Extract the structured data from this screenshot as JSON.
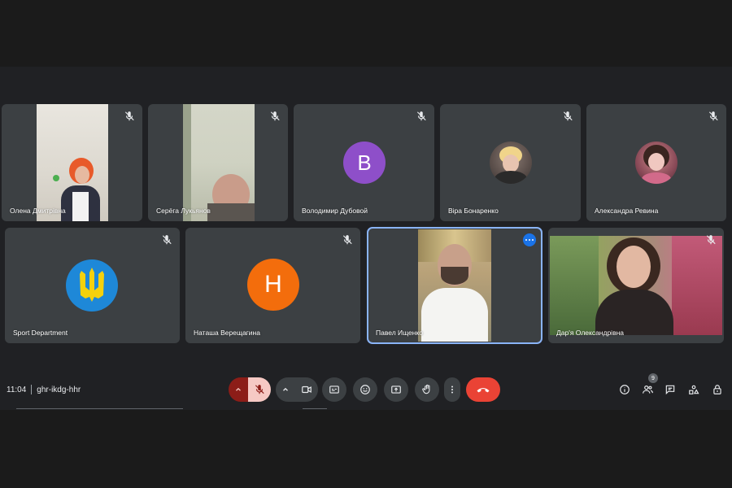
{
  "meeting": {
    "time": "11:04",
    "code": "ghr-ikdg-hhr"
  },
  "participants": [
    {
      "name": "Олена Дмитрівна"
    },
    {
      "name": "Серёга Лукьянов"
    },
    {
      "name": "Володимир Дубовой",
      "initial": "B"
    },
    {
      "name": "Віра Бонаренко"
    },
    {
      "name": "Александра Ревина"
    },
    {
      "name": "Sport Department"
    },
    {
      "name": "Наташа Верещагина",
      "initial": "H"
    },
    {
      "name": "Павел Ищенко"
    },
    {
      "name": "Дар'я Олександрівна"
    }
  ],
  "participants_badge": "9",
  "colors": {
    "tile_bg": "#3c4043",
    "avatar_purple": "#8e4fc9",
    "avatar_orange": "#f36d0c",
    "end_call_red": "#ea4335",
    "mic_muted_red": "#8c1d18",
    "active_outline": "#8ab4f8",
    "ukraine_blue": "#1e88d8",
    "ukraine_yellow": "#f5d10d"
  },
  "icons": {
    "tile": [
      "mic-off-icon",
      "more-options-icon"
    ],
    "controls": [
      "chevron-up-icon",
      "mic-off-icon",
      "chevron-up-icon",
      "camera-icon",
      "captions-icon",
      "emoji-icon",
      "present-icon",
      "raise-hand-icon",
      "more-vert-icon",
      "end-call-icon"
    ],
    "right": [
      "info-icon",
      "people-icon",
      "chat-icon",
      "activities-icon",
      "host-controls-icon"
    ]
  }
}
